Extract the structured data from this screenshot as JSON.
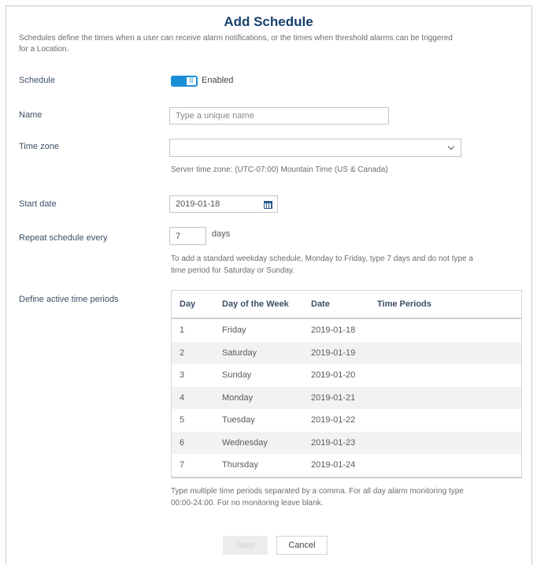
{
  "dialog": {
    "title": "Add Schedule",
    "description": "Schedules define the times when a user can receive alarm notifications, or the times when threshold alarms can be triggered for a Location."
  },
  "form": {
    "schedule": {
      "label": "Schedule",
      "toggle_state": "Enabled",
      "enabled": true
    },
    "name": {
      "label": "Name",
      "value": "",
      "placeholder": "Type a unique name"
    },
    "time_zone": {
      "label": "Time zone",
      "selected": "",
      "hint": "Server time zone: (UTC-07:00) Mountain Time (US & Canada)"
    },
    "start_date": {
      "label": "Start date",
      "value": "2019-01-18",
      "icon": "calendar-icon"
    },
    "repeat": {
      "label": "Repeat schedule every",
      "value": "7",
      "unit": "days",
      "hint": "To add a standard weekday schedule, Monday to Friday, type 7 days and do not type a time period for Saturday or Sunday."
    },
    "periods": {
      "label": "Define active time periods",
      "columns": [
        "Day",
        "Day of the Week",
        "Date",
        "Time Periods"
      ],
      "rows": [
        {
          "day": "1",
          "weekday": "Friday",
          "date": "2019-01-18",
          "periods": ""
        },
        {
          "day": "2",
          "weekday": "Saturday",
          "date": "2019-01-19",
          "periods": ""
        },
        {
          "day": "3",
          "weekday": "Sunday",
          "date": "2019-01-20",
          "periods": ""
        },
        {
          "day": "4",
          "weekday": "Monday",
          "date": "2019-01-21",
          "periods": ""
        },
        {
          "day": "5",
          "weekday": "Tuesday",
          "date": "2019-01-22",
          "periods": ""
        },
        {
          "day": "6",
          "weekday": "Wednesday",
          "date": "2019-01-23",
          "periods": ""
        },
        {
          "day": "7",
          "weekday": "Thursday",
          "date": "2019-01-24",
          "periods": ""
        }
      ],
      "note": "Type multiple time periods separated by a comma. For all day alarm monitoring type 00:00-24:00. For no monitoring leave blank."
    }
  },
  "buttons": {
    "save": "Save",
    "cancel": "Cancel"
  },
  "colors": {
    "accent": "#1a8fd6",
    "title": "#17406d",
    "row_alt": "#f2f2f2"
  }
}
